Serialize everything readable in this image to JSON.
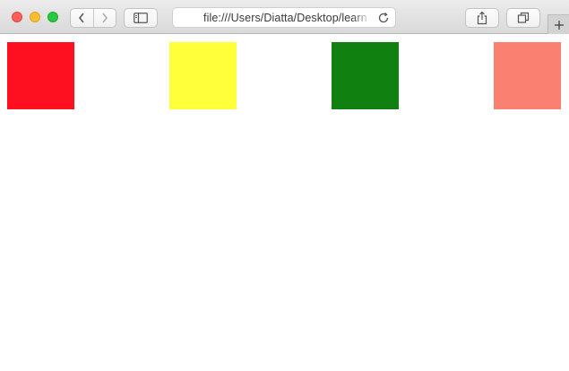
{
  "browser": {
    "url": "file:///Users/Diatta/Desktop/learn",
    "icons": {
      "back": "chevron-left-icon",
      "forward": "chevron-right-icon",
      "sidebar": "sidebar-icon",
      "reload": "reload-icon",
      "share": "share-icon",
      "tabs": "tabs-overview-icon",
      "new_tab": "plus-icon"
    }
  },
  "page": {
    "boxes": [
      {
        "color": "#ff1020"
      },
      {
        "color": "#ffff3a"
      },
      {
        "color": "#108010"
      },
      {
        "color": "#fa8072"
      }
    ]
  }
}
